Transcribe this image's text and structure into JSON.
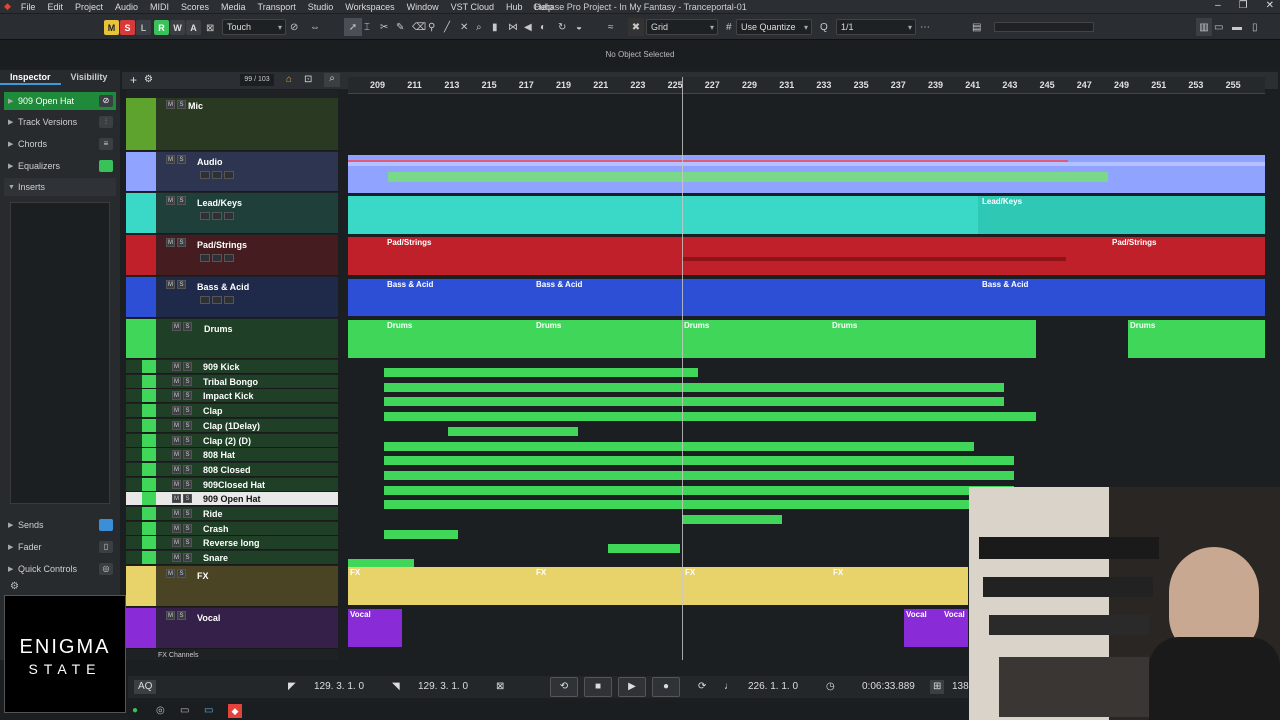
{
  "menubar": {
    "items": [
      "File",
      "Edit",
      "Project",
      "Audio",
      "MIDI",
      "Scores",
      "Media",
      "Transport",
      "Studio",
      "Workspaces",
      "Window",
      "VST Cloud",
      "Hub",
      "Help"
    ],
    "title": "Cubase Pro Project - In My Fantasy - Tranceportal-01"
  },
  "toolbar": {
    "m": "M",
    "s": "S",
    "l": "L",
    "r": "R",
    "w": "W",
    "a": "A",
    "touch": "Touch",
    "grid": "Grid",
    "quantize_type": "Use Quantize",
    "quantize_value": "1/1"
  },
  "status": "No Object Selected",
  "inspector": {
    "tab_inspector": "Inspector",
    "tab_visibility": "Visibility",
    "track": "909 Open Hat",
    "sections": [
      "Track Versions",
      "Chords",
      "Equalizers",
      "Inserts"
    ],
    "sends": "Sends",
    "fader": "Fader",
    "quick_controls": "Quick Controls"
  },
  "logo": {
    "line1": "ENIGMA",
    "line2": "STATE"
  },
  "projtb": {
    "count": "99 / 103"
  },
  "ruler": [
    "209",
    "211",
    "213",
    "215",
    "217",
    "219",
    "221",
    "223",
    "225",
    "227",
    "229",
    "231",
    "233",
    "235",
    "237",
    "239",
    "241",
    "243",
    "245",
    "247",
    "249",
    "251",
    "253",
    "255"
  ],
  "tracks": {
    "mic": "Mic",
    "audio": "Audio",
    "lead": "Lead/Keys",
    "pad": "Pad/Strings",
    "bass": "Bass & Acid",
    "drums": "Drums",
    "drum_subs": [
      "909 Kick",
      "Tribal Bongo",
      "Impact Kick",
      "Clap",
      "Clap (1Delay)",
      "Clap (2) (D)",
      "808 Hat",
      "808 Closed",
      "909Closed Hat",
      "909 Open Hat",
      "Ride",
      "Crash",
      "Reverse long",
      "Snare"
    ],
    "fx": "FX",
    "vocal": "Vocal",
    "fxchannels": "FX Channels"
  },
  "events": {
    "lead": "Lead/Keys",
    "pad": "Pad/Strings",
    "bass": "Bass & Acid",
    "drums": "Drums",
    "fx": "FX",
    "vocal": "Vocal"
  },
  "transport": {
    "left_locator": "129. 3. 1.   0",
    "right_locator": "129. 3. 1.   0",
    "position": "226. 1. 1.   0",
    "time": "0:06:33.889",
    "tempo": "138",
    "aq": "AQ"
  },
  "colors": {
    "audio": "#8fa3ff",
    "lead": "#3ad8c6",
    "pad": "#c0202a",
    "bass": "#2d4fd6",
    "drums": "#3fd65a",
    "fx": "#e8d26a",
    "vocal": "#8a2bd8",
    "mic": "#5da32e"
  }
}
